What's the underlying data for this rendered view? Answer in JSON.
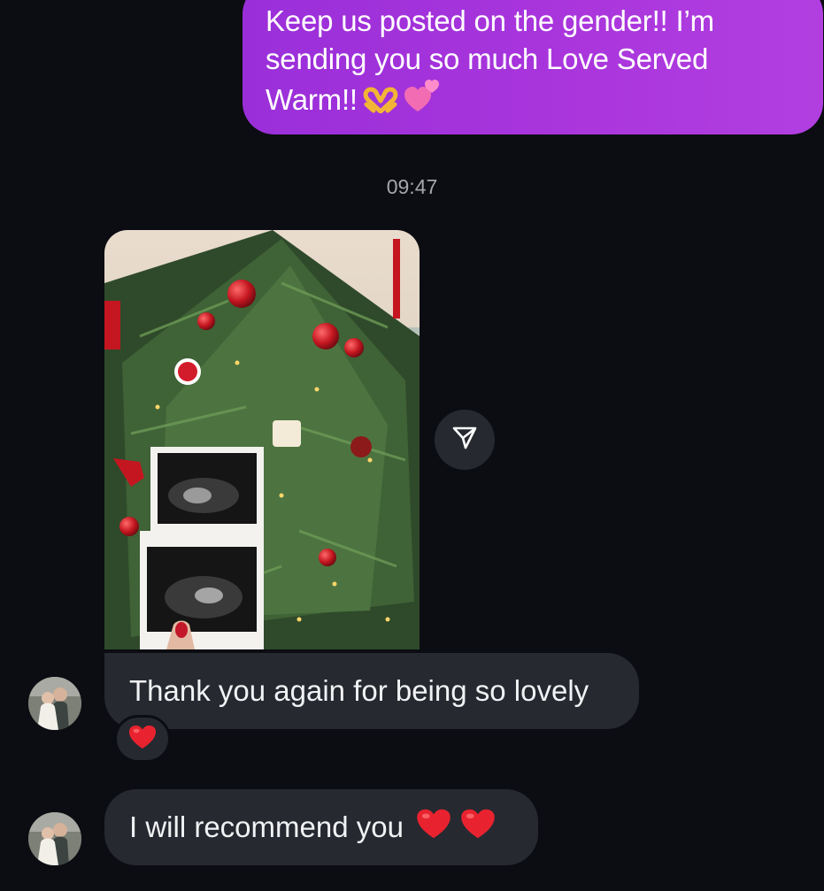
{
  "conversation": {
    "sent_message": {
      "line1": "Keep us posted on the gender!! I’m",
      "line2": "sending you so much Love Served",
      "line3": "Warm!!",
      "emojis": [
        "heart-hands-emoji",
        "two-hearts-emoji"
      ]
    },
    "timestamp": "09:47",
    "photo": {
      "icon": "shared-photo-ultrasound-christmas-tree"
    },
    "share_button": {
      "icon": "send-icon"
    },
    "received_messages": [
      {
        "text": "Thank you again for being so lovely",
        "reaction": "red-heart-emoji"
      },
      {
        "text": "I will recommend you",
        "emojis": [
          "red-heart-emoji",
          "red-heart-emoji"
        ]
      }
    ]
  },
  "colors": {
    "background": "#0b0d12",
    "sent_bubble": "#a935dc",
    "received_bubble": "#262930",
    "timestamp_text": "#a4a6ab",
    "heart": "#e8232f"
  }
}
